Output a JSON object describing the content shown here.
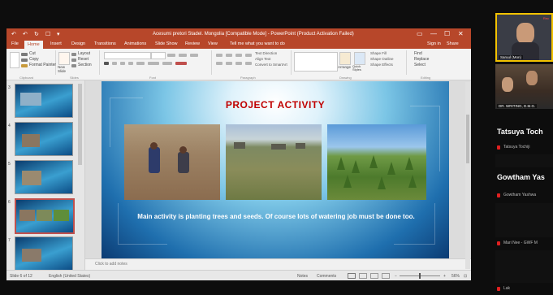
{
  "ppt": {
    "title": "Acesumi pretori Stadel. Mongolia [Compatible Mode] - PowerPoint (Product Activation Failed)",
    "quick_access": [
      "↶",
      "↻",
      "☐",
      "▾"
    ],
    "tabs": [
      "File",
      "Home",
      "Insert",
      "Design",
      "Transitions",
      "Animations",
      "Slide Show",
      "Review",
      "View",
      "Tell me what you want to do"
    ],
    "active_tab": "Home",
    "tab_right": [
      "Sign in",
      "Share"
    ],
    "window_controls": [
      "▭",
      "—",
      "☐",
      "✕"
    ],
    "ribbon_groups": [
      "Clipboard",
      "Slides",
      "Font",
      "Paragraph",
      "Drawing",
      "Editing"
    ],
    "ribbon_items": [
      "Cut",
      "Copy",
      "Format Painter",
      "New Slide",
      "Layout",
      "Reset",
      "Section",
      "Text Direction",
      "Align Text",
      "Convert to SmartArt",
      "Arrange",
      "Quick Styles",
      "Shape Fill",
      "Shape Outline",
      "Shape Effects",
      "Find",
      "Replace",
      "Select"
    ]
  },
  "slide": {
    "title": "PROJECT ACTIVITY",
    "caption": "Main activity is planting trees and seeds. Of course lots of watering job must be done too."
  },
  "thumbnails": [
    {
      "num": "3"
    },
    {
      "num": "4"
    },
    {
      "num": "5"
    },
    {
      "num": "6",
      "selected": true
    },
    {
      "num": "7"
    }
  ],
  "notes_placeholder": "Click to add notes",
  "status": {
    "slide_counter": "Slide 6 of 12",
    "language": "English (United States)",
    "notes": "Notes",
    "comments": "Comments",
    "zoom": "56%"
  },
  "participants": [
    {
      "tile_name": "Saruul (Mon)",
      "badge": "Rec"
    },
    {
      "tile_name": "DR. WRITING, D.M.G."
    },
    {
      "name": "Tatsuya Toch",
      "sub": "Tatsuya Tochiji"
    },
    {
      "name": "Gowtham Yas",
      "sub": "Gowtham Yashwa"
    },
    {
      "sub": "Mari Nee - GWF M"
    },
    {
      "sub": "Lak"
    }
  ],
  "colors": {
    "accent": "#b7472a",
    "slide_title": "#c00000",
    "active_speaker": "#f2c200"
  }
}
